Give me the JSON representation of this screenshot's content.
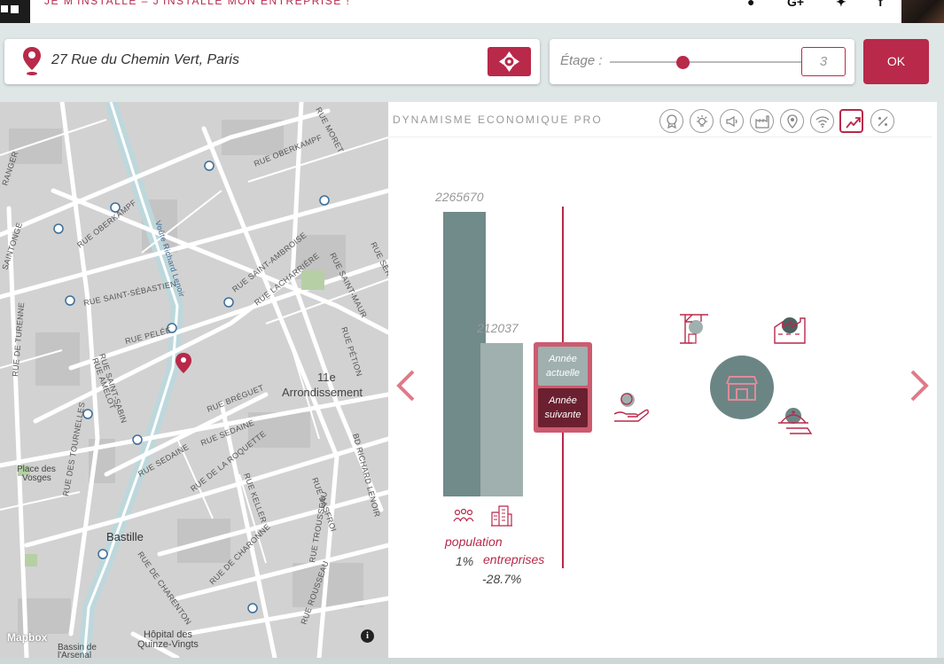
{
  "topbar": {
    "tagline": "JE M'INSTALLE – J'INSTALLE MON ENTREPRISE !",
    "social_icons": [
      "facebook-icon",
      "google-plus-icon",
      "twitter-icon",
      "facebook-f-icon"
    ]
  },
  "search": {
    "address": "27 Rue du Chemin Vert, Paris",
    "locate_icon": "crosshair-icon"
  },
  "floor": {
    "label": "Étage :",
    "value": "3",
    "slider_fraction": 0.38,
    "ok_label": "OK"
  },
  "map": {
    "attribution": "Mapbox",
    "info": "i",
    "arrondissement_num": "11e",
    "arrondissement_word": "Arrondissement",
    "places": {
      "vosges_1": "Place des",
      "vosges_2": "Vosges",
      "bastille": "Bastille",
      "hopital_1": "Hôpital des",
      "hopital_2": "Quinze-Vingts",
      "bassin_1": "Bassin de",
      "bassin_2": "l'Arsenal"
    },
    "streets": {
      "oberkampf_1": "RUE OBERKAMPF",
      "oberkampf_2": "RUE OBERKAMPF",
      "moret": "RUE MORET",
      "richard_lenoir": "Voûte Richard Lenoir",
      "saint_sebastien": "RUE SAINT-SÉBASTIEN",
      "saint_ambroise": "RUE SAINT-AMBROISE",
      "lacharriere": "RUE LACHARRIÈRE",
      "saint_maur": "RUE SAINT-MAUR",
      "servan": "RUE SERVAN",
      "pelee": "RUE PELÉE",
      "turenne": "RUE DE TURENNE",
      "saintonge": "SAINTONGE",
      "amelot": "RUE AMELOT",
      "saint_sabin": "RUE SAINT-SABIN",
      "breguet": "RUE BRÉGUET",
      "sedaine_1": "RUE SEDAINE",
      "sedaine_2": "RUE SEDAINE",
      "petion": "RUE PÉTION",
      "roquette": "RUE DE LA ROQUETTE",
      "richard_lenoir_bd": "BD RICHARD LENOIR",
      "keller": "RUE KELLER",
      "basfroi": "RUE BASFROI",
      "tournelles": "RUE DES TOURNELLES",
      "charonne": "RUE DE CHARONNE",
      "charenton": "RUE DE CHARENTON",
      "trousseau": "RUE TROUSSEAU",
      "roussel": "RUE ROUSSEAU",
      "ranger": "RANGER"
    }
  },
  "panel": {
    "title": "DYNAMISME ECONOMIQUE PRO",
    "categories": [
      "award-icon",
      "lightbulb-icon",
      "megaphone-icon",
      "factory-icon",
      "location-pin-icon",
      "wifi-icon",
      "trend-up-icon",
      "percent-icon"
    ],
    "active_category": "trend-up-icon"
  },
  "stats": {
    "population_value": "2265670",
    "entreprises_value": "212037",
    "population_label": "population",
    "population_change": "1%",
    "entreprises_label": "entreprises",
    "entreprises_change": "-28.7%",
    "year_current": "Année actuelle",
    "year_next": "Année suivante"
  },
  "sectors": [
    "construction-crane-icon",
    "factory-bubble-icon",
    "shop-icon",
    "hand-service-icon",
    "food-cloche-icon"
  ],
  "colors": {
    "accent": "#b8294a",
    "bar_population": "#718a8a",
    "bar_entreprises": "#9fb0af",
    "bubble": "#6b8585"
  }
}
